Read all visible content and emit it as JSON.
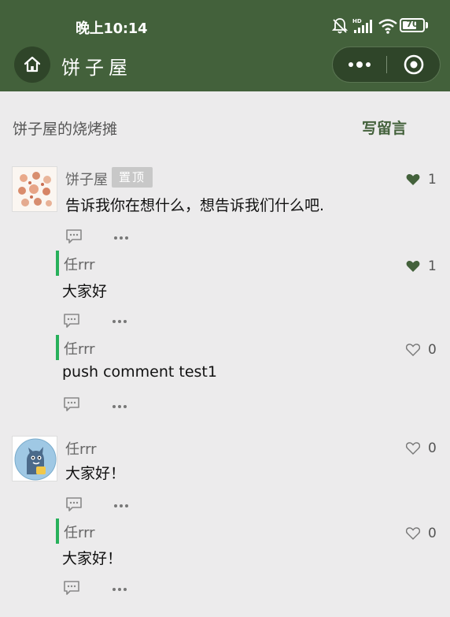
{
  "status_bar": {
    "time": "晚上10:14",
    "battery": "70",
    "battery_percent": 70,
    "icons": [
      "bell-off-icon",
      "hd-signal-icon",
      "wifi-icon",
      "battery-icon"
    ]
  },
  "nav": {
    "title": "饼子屋",
    "home_icon": "home-icon",
    "more_icon": "more-dots-icon",
    "close_icon": "target-close-icon"
  },
  "board": {
    "title": "饼子屋的烧烤摊",
    "write_label": "写留言"
  },
  "colors": {
    "header_bg": "#43613b",
    "accent": "#43613b",
    "reply_bar": "#28b05b",
    "page_bg": "#ecebec"
  },
  "comments": [
    {
      "author": "饼子屋",
      "badge": "置顶",
      "content": "告诉我你在想什么，想告诉我们什么吧.",
      "likes": "1",
      "liked": true,
      "replies": [
        {
          "author": "任rrr",
          "content": "大家好",
          "likes": "1",
          "liked": true
        },
        {
          "author": "任rrr",
          "content": "push comment test1",
          "likes": "0",
          "liked": false
        }
      ]
    },
    {
      "author": "任rrr",
      "content": "大家好！",
      "likes": "0",
      "liked": false,
      "replies": [
        {
          "author": "任rrr",
          "content": "大家好！",
          "likes": "0",
          "liked": false
        }
      ]
    }
  ]
}
